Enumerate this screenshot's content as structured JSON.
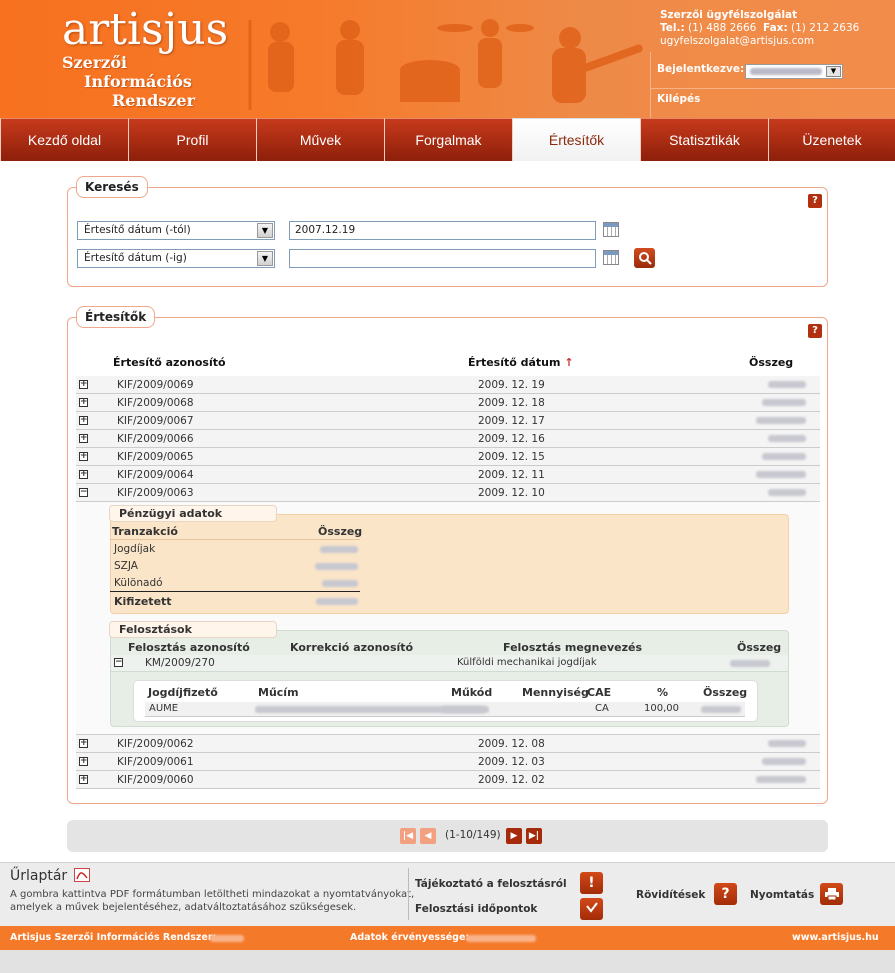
{
  "header": {
    "logo": "artisjus",
    "logo_line1": "Szerzői",
    "logo_line2": "Információs",
    "logo_line3": "Rendszer",
    "support_title": "Szerzői ügyfélszolgálat",
    "tel_label": "Tel.:",
    "tel": "(1) 488 2666",
    "fax_label": "Fax:",
    "fax": "(1) 212 2636",
    "email": "ugyfelszolgalat@artisjus.com",
    "logged_in_label": "Bejelentkezve:",
    "logout": "Kilépés"
  },
  "tabs": [
    {
      "label": "Kezdő oldal"
    },
    {
      "label": "Profil"
    },
    {
      "label": "Művek"
    },
    {
      "label": "Forgalmak"
    },
    {
      "label": "Értesítők"
    },
    {
      "label": "Statisztikák"
    },
    {
      "label": "Üzenetek"
    }
  ],
  "search": {
    "legend": "Keresés",
    "help": "?",
    "from_select": "Értesítő dátum (-tól)",
    "to_select": "Értesítő dátum (-ig)",
    "from_value": "2007.12.19",
    "to_value": ""
  },
  "results": {
    "legend": "Értesítők",
    "help": "?",
    "col_id": "Értesítő azonosító",
    "col_date": "Értesítő dátum",
    "sort_arrow": "↑",
    "col_amount": "Összeg",
    "rows": [
      {
        "id": "KIF/2009/0069",
        "date": "2009. 12. 19",
        "exp": "+"
      },
      {
        "id": "KIF/2009/0068",
        "date": "2009. 12. 18",
        "exp": "+"
      },
      {
        "id": "KIF/2009/0067",
        "date": "2009. 12. 17",
        "exp": "+"
      },
      {
        "id": "KIF/2009/0066",
        "date": "2009. 12. 16",
        "exp": "+"
      },
      {
        "id": "KIF/2009/0065",
        "date": "2009. 12. 15",
        "exp": "+"
      },
      {
        "id": "KIF/2009/0064",
        "date": "2009. 12. 11",
        "exp": "+"
      },
      {
        "id": "KIF/2009/0063",
        "date": "2009. 12. 10",
        "exp": "−"
      }
    ],
    "rows_after": [
      {
        "id": "KIF/2009/0062",
        "date": "2009. 12. 08",
        "exp": "+"
      },
      {
        "id": "KIF/2009/0061",
        "date": "2009. 12. 03",
        "exp": "+"
      },
      {
        "id": "KIF/2009/0060",
        "date": "2009. 12. 02",
        "exp": "+"
      }
    ]
  },
  "financial": {
    "legend": "Pénzügyi adatok",
    "col_tx": "Tranzakció",
    "col_amount": "Összeg",
    "items": [
      "Jogdíjak",
      "SZJA",
      "Különadó"
    ],
    "total": "Kifizetett"
  },
  "distribution": {
    "legend": "Felosztások",
    "col_id": "Felosztás azonosító",
    "col_corr": "Korrekció azonosító",
    "col_name": "Felosztás megnevezés",
    "col_amount": "Összeg",
    "row_exp": "−",
    "row_id": "KM/2009/270",
    "row_name": "Külföldi mechanikai jogdíjak",
    "detail_cols": {
      "payer": "Jogdíjfizető",
      "title": "Műcím",
      "work": "Műkód",
      "qty": "Mennyiség",
      "cae": "CAE",
      "pct": "%",
      "amount": "Összeg"
    },
    "detail_row": {
      "payer": "AUME",
      "cae": "CA",
      "pct": "100,00"
    }
  },
  "pager": {
    "first": "|◀",
    "prev": "◀",
    "info": "(1-10/149)",
    "next": "▶",
    "last": "▶|"
  },
  "footer": {
    "forms_title": "Űrlaptár",
    "forms_text1": "A gombra kattintva PDF formátumban letöltheti mindazokat a nyomtatványokat,",
    "forms_text2": "amelyek a művek bejelentéséhez, adatváltoztatásához szükségesek.",
    "info_link": "Tájékoztató a felosztásról",
    "dates_link": "Felosztási időpontok",
    "shortcuts": "Rövidítések",
    "print": "Nyomtatás",
    "info_icon": "!",
    "shortcuts_icon": "?",
    "system_label": "Artisjus Szerzői Információs Rendszer:",
    "validity_label": "Adatok érvényessége:",
    "website": "www.artisjus.hu"
  },
  "colors": {
    "brand_orange": "#f47a2a",
    "tab_red": "#a52a0a",
    "finance_bg": "#fbe5c9",
    "distribution_bg": "#e6eee6"
  }
}
